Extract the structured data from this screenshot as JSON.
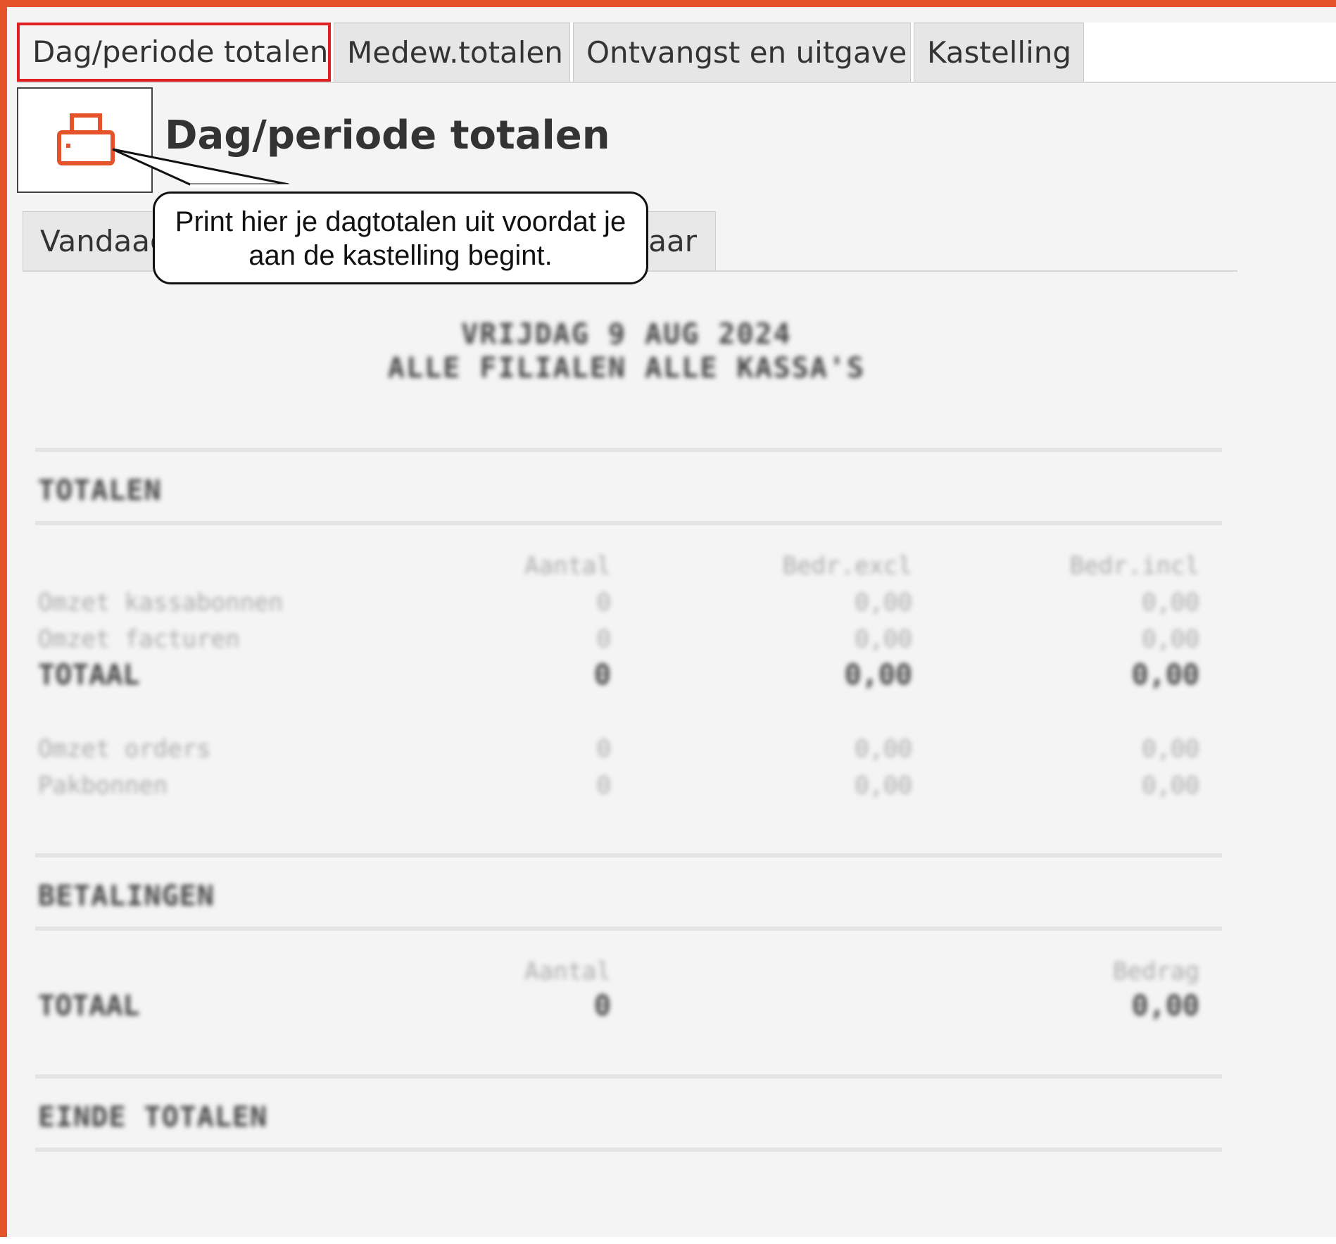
{
  "tabs": {
    "items": [
      "Dag/periode totalen",
      "Medew.totalen",
      "Ontvangst en uitgave",
      "Kastelling"
    ]
  },
  "page": {
    "title": "Dag/periode totalen",
    "subtab_left": "Vandaag",
    "subtab_right": "aar",
    "callout": "Print hier je dagtotalen uit voordat je aan de kastelling begint."
  },
  "report": {
    "header_line1": "VRIJDAG 9 AUG 2024",
    "header_line2": "ALLE FILIALEN ALLE KASSA'S",
    "section_totalen": "TOTALEN",
    "columns": [
      "Aantal",
      "Bedr.excl",
      "Bedr.incl"
    ],
    "rows": [
      {
        "label": "Omzet kassabonnen",
        "aantal": "0",
        "excl": "0,00",
        "incl": "0,00"
      },
      {
        "label": "Omzet facturen",
        "aantal": "0",
        "excl": "0,00",
        "incl": "0,00"
      }
    ],
    "totaal": {
      "label": "TOTAAL",
      "aantal": "0",
      "excl": "0,00",
      "incl": "0,00"
    },
    "rows2": [
      {
        "label": "Omzet orders",
        "aantal": "0",
        "excl": "0,00",
        "incl": "0,00"
      },
      {
        "label": "Pakbonnen",
        "aantal": "0",
        "excl": "0,00",
        "incl": "0,00"
      }
    ],
    "section_betalingen": "BETALINGEN",
    "betalingen_columns": [
      "Aantal",
      "Bedrag"
    ],
    "betalingen_totaal": {
      "label": "TOTAAL",
      "aantal": "0",
      "bedrag": "0,00"
    },
    "section_einde": "EINDE TOTALEN"
  },
  "colors": {
    "accent": "#e4532a",
    "active_tab_border": "#e02020"
  }
}
